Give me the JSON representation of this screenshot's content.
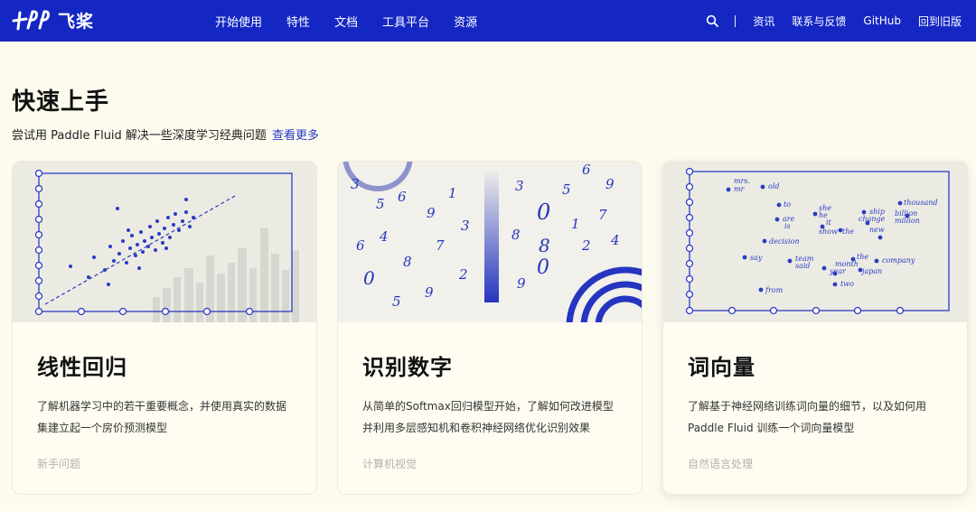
{
  "nav": {
    "logo_text": "飞桨",
    "links": [
      "开始使用",
      "特性",
      "文档",
      "工具平台",
      "资源"
    ],
    "right_links": [
      "资讯",
      "联系与反馈",
      "GitHub",
      "回到旧版"
    ],
    "search_icon": "search-icon"
  },
  "section": {
    "title": "快速上手",
    "subtitle": "尝试用 Paddle Fluid 解决一些深度学习经典问题",
    "more_link": "查看更多"
  },
  "cards": [
    {
      "title": "线性回归",
      "desc_line1": "了解机器学习中的若干重要概念，并使用真实的数据",
      "desc_line2": "集建立起一个房价预测模型",
      "tag": "新手问题"
    },
    {
      "title": "识别数字",
      "desc_line1": "从简单的Softmax回归模型开始，了解如何改进模型",
      "desc_line2": "并利用多层感知机和卷积神经网络优化识别效果",
      "tag": "计算机视觉"
    },
    {
      "title": "词向量",
      "desc_line1": "了解基于神经网络训练词向量的细节，以及如何用",
      "desc_line2": "Paddle Fluid 训练一个词向量模型",
      "tag": "自然语言处理"
    }
  ],
  "word_cloud": [
    "mrs.",
    "mr",
    "old",
    "to",
    "are",
    "is",
    "she",
    "he",
    "it",
    "ship",
    "thousand",
    "billion",
    "million",
    "change",
    "new",
    "show",
    "the",
    "decision",
    "say",
    "team",
    "said",
    "the",
    "month",
    "year",
    "japan",
    "company",
    "from",
    "two"
  ],
  "digit_text": [
    "3",
    "5",
    "6",
    "9",
    "1",
    "0",
    "8",
    "7",
    "2",
    "4"
  ],
  "colors": {
    "brand": "#1527c3",
    "accent": "#2738c9",
    "background": "#fdfbee"
  }
}
